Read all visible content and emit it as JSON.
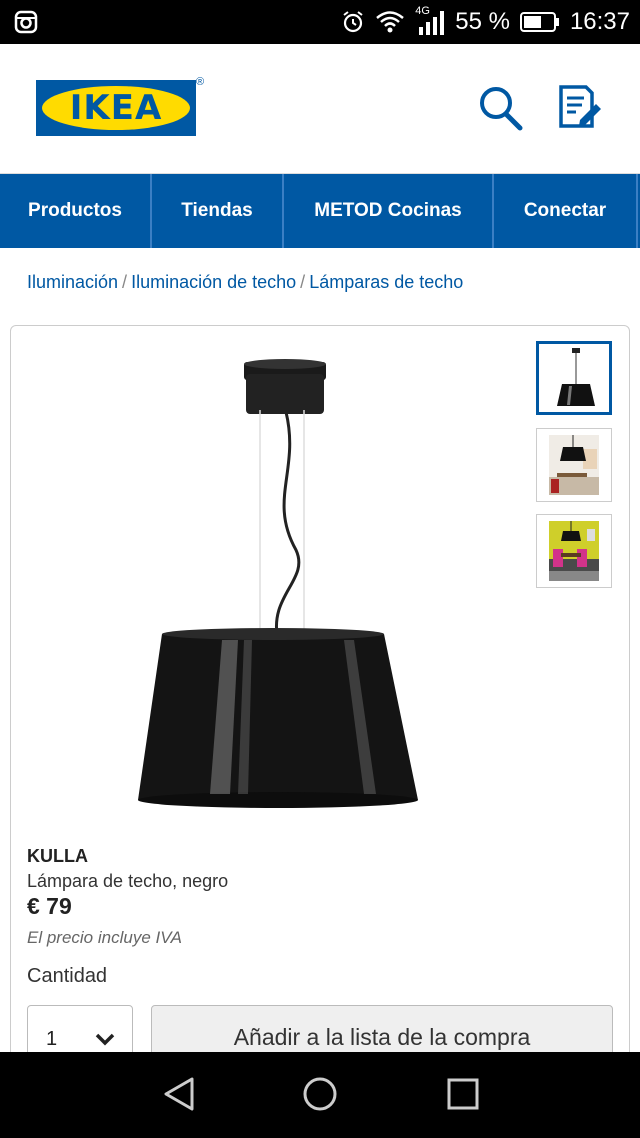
{
  "status_bar": {
    "network": "4G",
    "battery": "55 %",
    "time": "16:37"
  },
  "header": {
    "logo_text": "IKEA",
    "logo_registered": "®"
  },
  "nav": {
    "items": [
      {
        "label": "Productos"
      },
      {
        "label": "Tiendas"
      },
      {
        "label": "METOD Cocinas"
      },
      {
        "label": "Conectar"
      }
    ]
  },
  "breadcrumb": {
    "items": [
      "Iluminación",
      "Iluminación de techo",
      "Lámparas de techo"
    ],
    "separator": "/"
  },
  "product": {
    "name": "KULLA",
    "description": "Lámpara de techo, negro",
    "price": "€ 79",
    "vat_note": "El precio incluye IVA",
    "quantity_label": "Cantidad",
    "quantity_value": "1",
    "add_button_label": "Añadir a la lista de la compra"
  },
  "colors": {
    "brand_blue": "#0058a3",
    "brand_yellow": "#ffdb00"
  },
  "icons": [
    "instagram-icon",
    "alarm-icon",
    "wifi-icon",
    "signal-icon",
    "battery-icon",
    "search-icon",
    "shopping-list-icon",
    "chevron-down-icon",
    "back-icon",
    "home-icon",
    "recents-icon"
  ]
}
